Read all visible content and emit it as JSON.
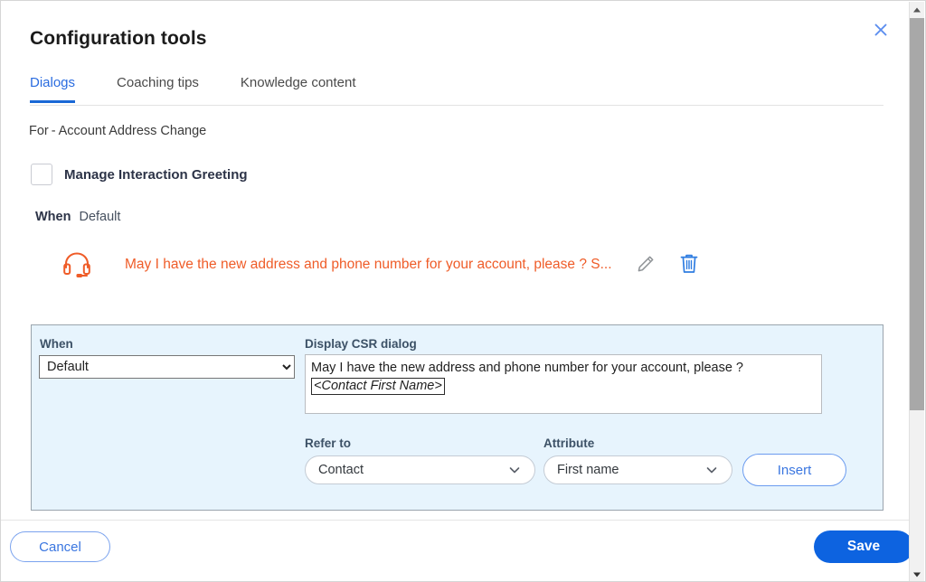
{
  "window": {
    "title": "Configuration tools",
    "close_icon": "close-icon"
  },
  "tabs": [
    {
      "label": "Dialogs",
      "active": true
    },
    {
      "label": "Coaching tips",
      "active": false
    },
    {
      "label": "Knowledge content",
      "active": false
    }
  ],
  "context": {
    "for_label": "For",
    "separator": "-",
    "for_value": "Account Address Change"
  },
  "greeting": {
    "checkbox_label": "Manage Interaction Greeting",
    "checked": false,
    "when_key": "When",
    "when_value": "Default",
    "dialog_icon": "headset-icon",
    "dialog_text": "May I have the new address and phone number for your account, please ? S...",
    "dialog_text_color": "#ef5c28",
    "edit_icon": "pencil-icon",
    "delete_icon": "trash-icon"
  },
  "editor": {
    "when_label": "When",
    "when_selected": "Default",
    "when_options": [
      "Default"
    ],
    "csr_label": "Display CSR dialog",
    "csr_text": "May I have the new address and phone number for your account, please ?",
    "csr_token": "<Contact First Name>",
    "refer_label": "Refer to",
    "refer_selected": "Contact",
    "attribute_label": "Attribute",
    "attribute_selected": "First name",
    "insert_label": "Insert",
    "chevron_icon": "chevron-down-icon",
    "panel_color": "#e7f4fd"
  },
  "footer": {
    "cancel_label": "Cancel",
    "save_label": "Save",
    "save_color": "#0d63e0",
    "link_color": "#3a76e0"
  },
  "scrollbar": {
    "up_icon": "caret-up-icon",
    "down_icon": "caret-down-icon"
  }
}
